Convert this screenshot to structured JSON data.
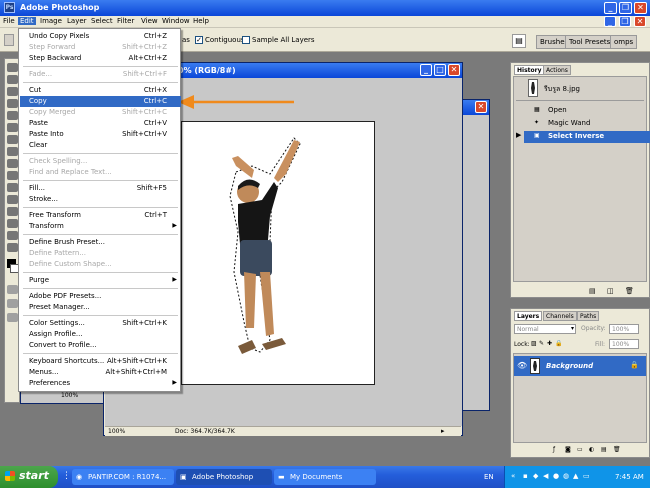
{
  "app": {
    "title": "Adobe Photoshop",
    "menu": [
      "File",
      "Edit",
      "Image",
      "Layer",
      "Select",
      "Filter",
      "View",
      "Window",
      "Help"
    ],
    "active_menu": "Edit"
  },
  "options_bar": {
    "partial_label": "as",
    "contiguous_label": "Contiguous",
    "contiguous_checked": true,
    "sample_all_label": "Sample All Layers",
    "sample_all_checked": false,
    "panel_tabs": [
      "Brushes",
      "Tool Presets",
      "omps"
    ]
  },
  "edit_menu": {
    "items": [
      {
        "label": "Undo Copy Pixels",
        "shortcut": "Ctrl+Z",
        "disabled": false
      },
      {
        "label": "Step Forward",
        "shortcut": "Shift+Ctrl+Z",
        "disabled": true
      },
      {
        "label": "Step Backward",
        "shortcut": "Alt+Ctrl+Z",
        "disabled": false
      },
      {
        "sep": true
      },
      {
        "label": "Fade...",
        "shortcut": "Shift+Ctrl+F",
        "disabled": true
      },
      {
        "sep": true
      },
      {
        "label": "Cut",
        "shortcut": "Ctrl+X",
        "disabled": false
      },
      {
        "label": "Copy",
        "shortcut": "Ctrl+C",
        "disabled": false,
        "highlighted": true
      },
      {
        "label": "Copy Merged",
        "shortcut": "Shift+Ctrl+C",
        "disabled": true
      },
      {
        "label": "Paste",
        "shortcut": "Ctrl+V",
        "disabled": false
      },
      {
        "label": "Paste Into",
        "shortcut": "Shift+Ctrl+V",
        "disabled": false
      },
      {
        "label": "Clear",
        "shortcut": "",
        "disabled": false
      },
      {
        "sep": true
      },
      {
        "label": "Check Spelling...",
        "shortcut": "",
        "disabled": true
      },
      {
        "label": "Find and Replace Text...",
        "shortcut": "",
        "disabled": true
      },
      {
        "sep": true
      },
      {
        "label": "Fill...",
        "shortcut": "Shift+F5",
        "disabled": false
      },
      {
        "label": "Stroke...",
        "shortcut": "",
        "disabled": false
      },
      {
        "sep": true
      },
      {
        "label": "Free Transform",
        "shortcut": "Ctrl+T",
        "disabled": false
      },
      {
        "label": "Transform",
        "shortcut": "",
        "disabled": false,
        "submenu": true
      },
      {
        "sep": true
      },
      {
        "label": "Define Brush Preset...",
        "shortcut": "",
        "disabled": false
      },
      {
        "label": "Define Pattern...",
        "shortcut": "",
        "disabled": true
      },
      {
        "label": "Define Custom Shape...",
        "shortcut": "",
        "disabled": true
      },
      {
        "sep": true
      },
      {
        "label": "Purge",
        "shortcut": "",
        "disabled": false,
        "submenu": true
      },
      {
        "sep": true
      },
      {
        "label": "Adobe PDF Presets...",
        "shortcut": "",
        "disabled": false
      },
      {
        "label": "Preset Manager...",
        "shortcut": "",
        "disabled": false
      },
      {
        "sep": true
      },
      {
        "label": "Color Settings...",
        "shortcut": "Shift+Ctrl+K",
        "disabled": false
      },
      {
        "label": "Assign Profile...",
        "shortcut": "",
        "disabled": false
      },
      {
        "label": "Convert to Profile...",
        "shortcut": "",
        "disabled": false
      },
      {
        "sep": true
      },
      {
        "label": "Keyboard Shortcuts...",
        "shortcut": "Alt+Shift+Ctrl+K",
        "disabled": false
      },
      {
        "label": "Menus...",
        "shortcut": "Alt+Shift+Ctrl+M",
        "disabled": false
      },
      {
        "label": "Preferences",
        "shortcut": "",
        "disabled": false,
        "submenu": true
      }
    ]
  },
  "document": {
    "title_partial": "0% (RGB/8#)",
    "zoom": "100%",
    "doc_size": "Doc: 364.7K/364.7K",
    "bg_zoom": "100%"
  },
  "history": {
    "tabs": [
      "History",
      "Actions"
    ],
    "snapshot_label": "รีบรูล 8.jpg",
    "items": [
      {
        "label": "Open",
        "selected": false
      },
      {
        "label": "Magic Wand",
        "selected": false
      },
      {
        "label": "Select Inverse",
        "selected": true
      }
    ]
  },
  "layers": {
    "tabs": [
      "Layers",
      "Channels",
      "Paths"
    ],
    "blend_mode": "Normal",
    "opacity_label": "Opacity:",
    "opacity_value": "100%",
    "lock_label": "Lock:",
    "fill_label": "Fill:",
    "fill_value": "100%",
    "layer_name": "Background"
  },
  "taskbar": {
    "start_label": "start",
    "tasks": [
      "PANTIP.COM : R1074...",
      "Adobe Photoshop",
      "My Documents"
    ],
    "active_task": "Adobe Photoshop",
    "lang": "EN",
    "clock": "7:45 AM"
  },
  "colors": {
    "xp_blue": "#0a46d8",
    "menu_highlight": "#316ac5",
    "arrow_orange": "#f08a1c",
    "history_selected": "#316ac5"
  }
}
